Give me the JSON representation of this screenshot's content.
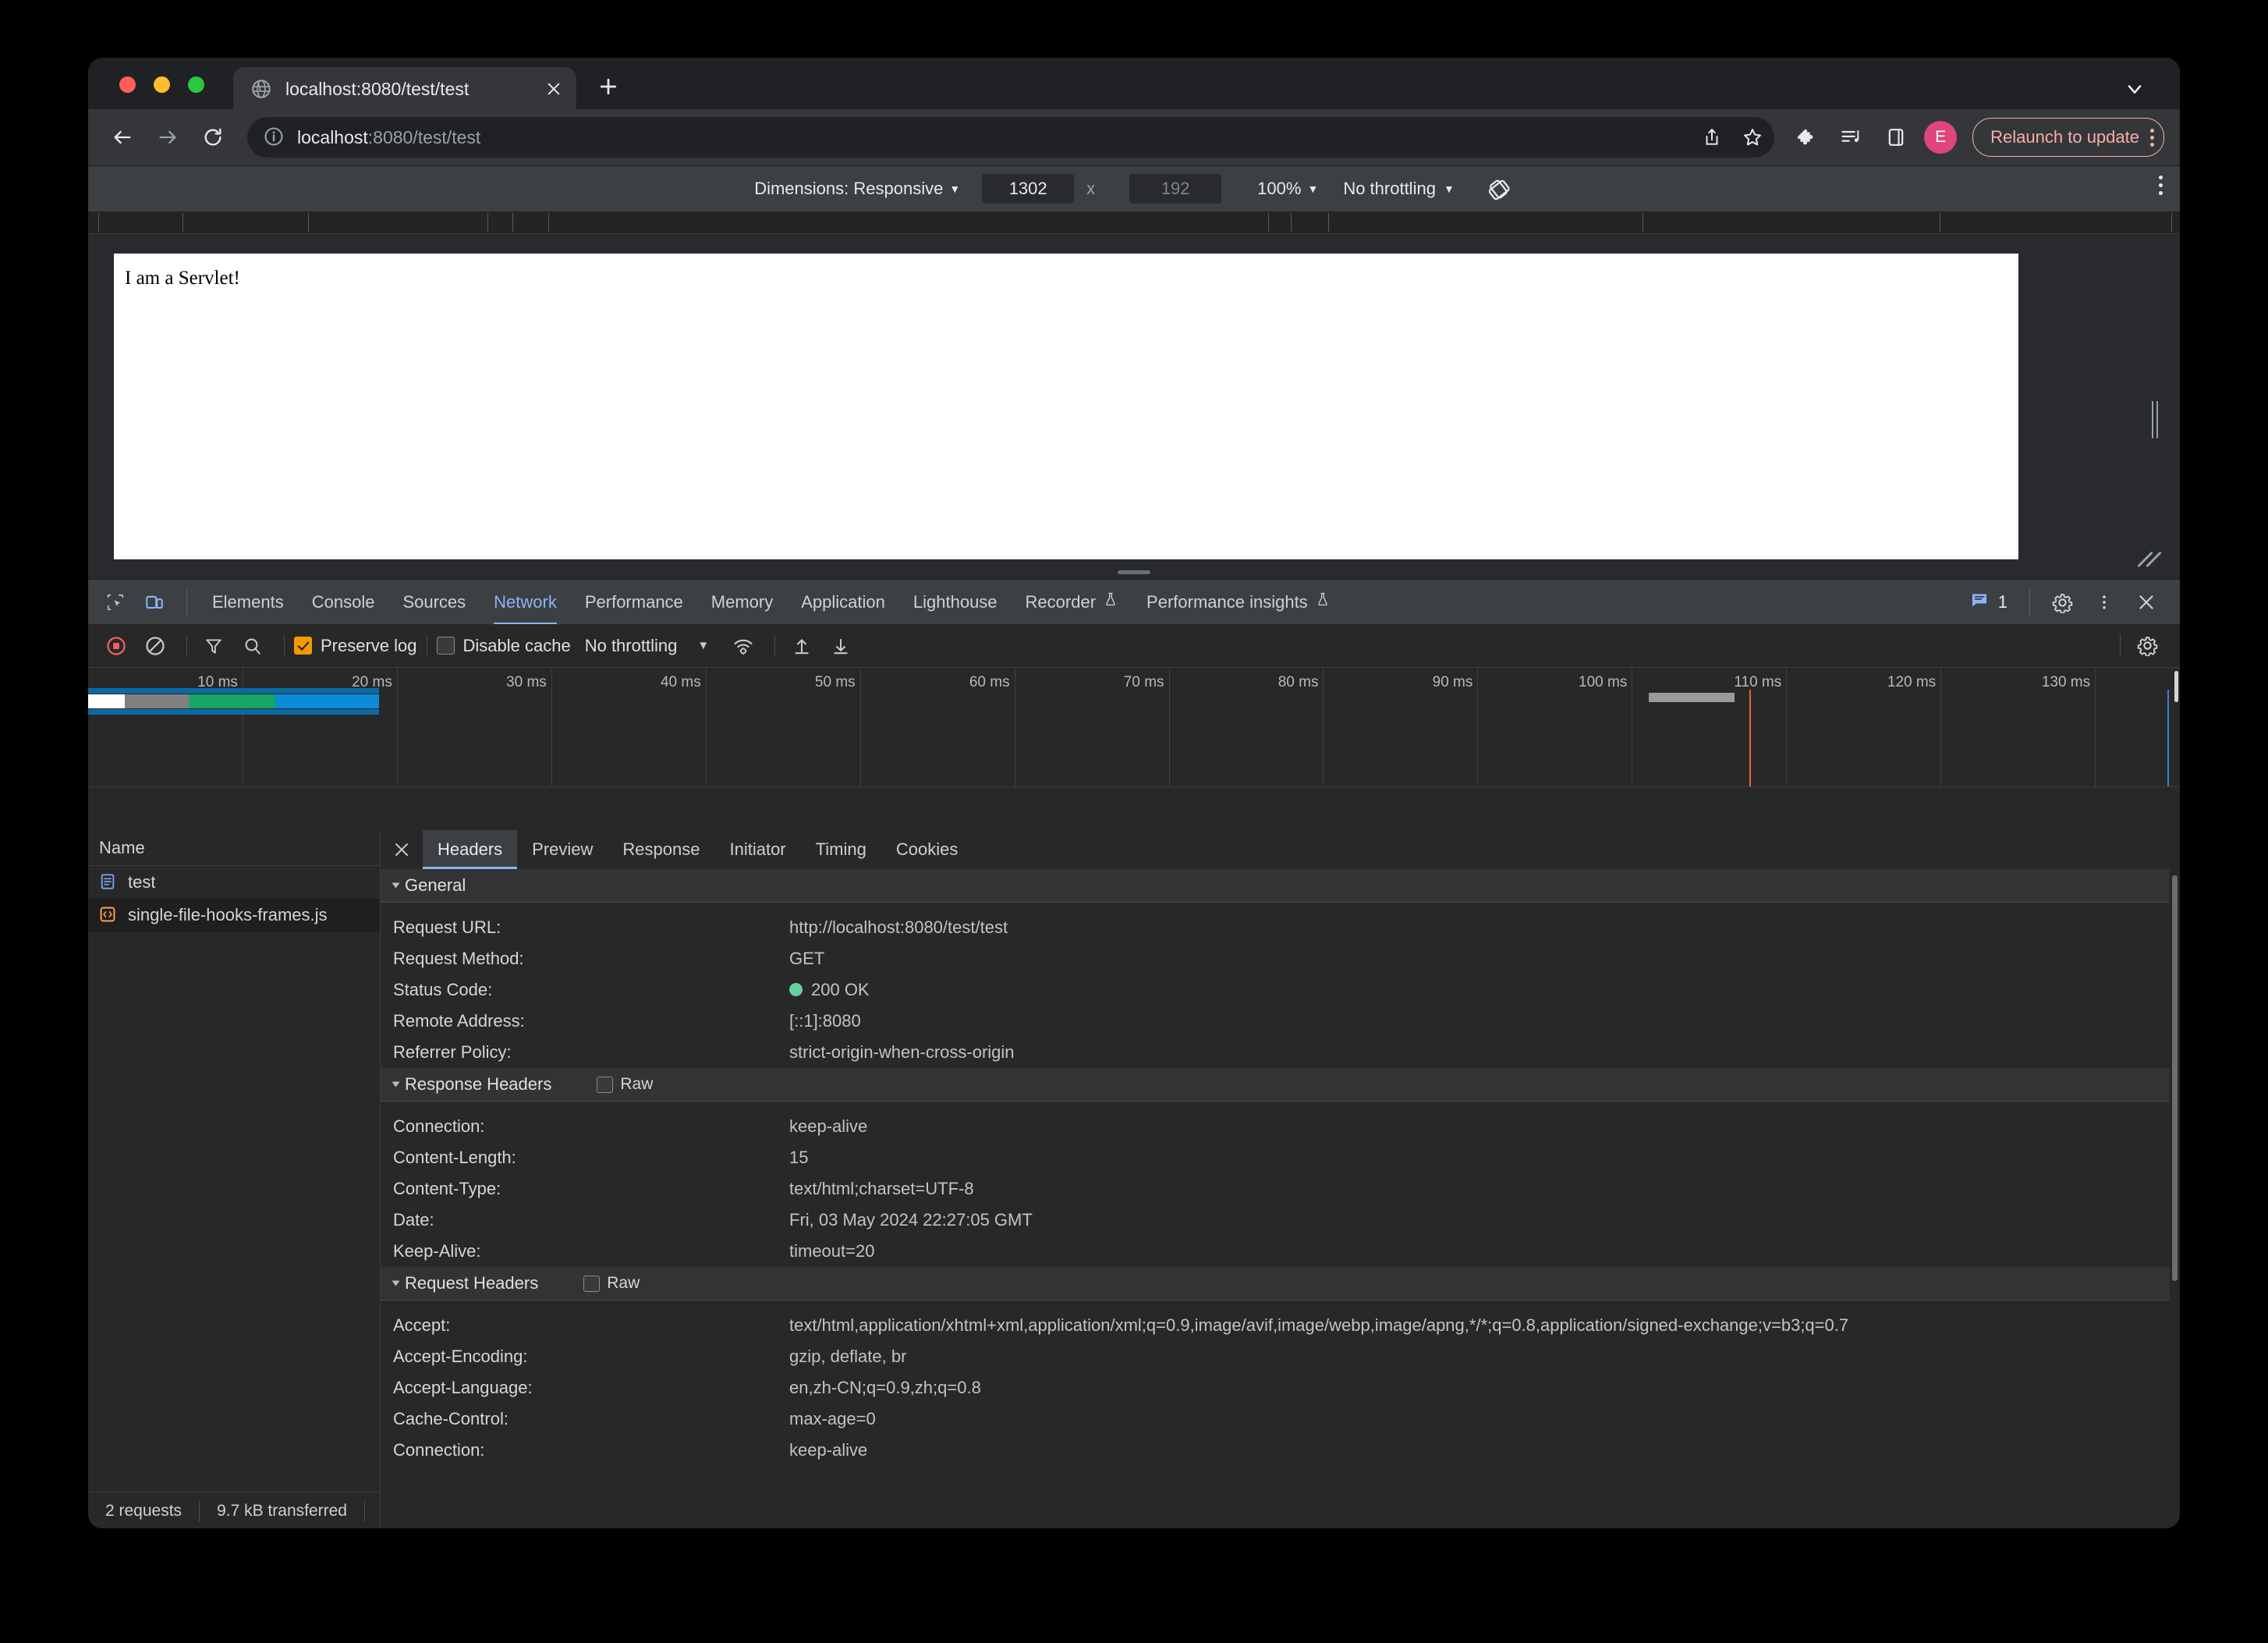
{
  "browser": {
    "tab": {
      "title": "localhost:8080/test/test",
      "favicon_icon": "globe-icon",
      "close_icon": "close-icon"
    },
    "new_tab_icon": "plus-icon",
    "tab_list_chevron_icon": "chevron-down-icon",
    "nav": {
      "back_icon": "arrow-left-icon",
      "forward_icon": "arrow-right-icon",
      "reload_icon": "reload-icon"
    },
    "omnibox": {
      "info_icon": "info-circle-icon",
      "url_host": "localhost",
      "url_rest": ":8080/test/test",
      "share_icon": "share-icon",
      "bookmark_icon": "star-icon"
    },
    "actions": {
      "extensions_icon": "puzzle-icon",
      "reading_list_icon": "media-list-icon",
      "side_panel_icon": "side-panel-icon",
      "avatar_label": "E",
      "avatar_color": "#e0457b",
      "relaunch_label": "Relaunch to update",
      "relaunch_color": "#f6aea9",
      "relaunch_menu_icon": "kebab-menu-icon"
    }
  },
  "device_toolbar": {
    "dimensions_label": "Dimensions: Responsive",
    "dimensions_caret_icon": "caret-down-icon",
    "width_value": "1302",
    "x_label": "x",
    "height_placeholder": "192",
    "zoom_label": "100%",
    "zoom_caret_icon": "caret-down-icon",
    "throttling_label": "No throttling",
    "throttling_caret_icon": "caret-down-icon",
    "rotate_icon": "rotate-device-icon",
    "more_icon": "kebab-menu-icon"
  },
  "page": {
    "body_text": "I am a Servlet!",
    "resize_handle_icon": "vertical-grip-icon",
    "corner_resize_icon": "corner-resize-icon",
    "drawer_grip_icon": "horizontal-grip-icon"
  },
  "devtools": {
    "inspect_icon": "inspect-element-icon",
    "device_toggle_icon": "device-toolbar-icon",
    "panels": [
      {
        "label": "Elements",
        "selected": false,
        "experimental": false
      },
      {
        "label": "Console",
        "selected": false,
        "experimental": false
      },
      {
        "label": "Sources",
        "selected": false,
        "experimental": false
      },
      {
        "label": "Network",
        "selected": true,
        "experimental": false
      },
      {
        "label": "Performance",
        "selected": false,
        "experimental": false
      },
      {
        "label": "Memory",
        "selected": false,
        "experimental": false
      },
      {
        "label": "Application",
        "selected": false,
        "experimental": false
      },
      {
        "label": "Lighthouse",
        "selected": false,
        "experimental": false
      },
      {
        "label": "Recorder",
        "selected": false,
        "experimental": true
      },
      {
        "label": "Performance insights",
        "selected": false,
        "experimental": true
      }
    ],
    "message_icon": "console-message-icon",
    "message_count": "1",
    "settings_icon": "gear-icon",
    "more_icon": "kebab-menu-icon",
    "close_icon": "close-icon"
  },
  "network_toolbar": {
    "record_icon": "record-stop-icon",
    "clear_icon": "clear-circle-icon",
    "filter_icon": "funnel-icon",
    "search_icon": "search-icon",
    "preserve_log_label": "Preserve log",
    "preserve_log_checked": true,
    "disable_cache_label": "Disable cache",
    "disable_cache_checked": false,
    "throttling_label": "No throttling",
    "throttling_caret_icon": "caret-down-icon",
    "wifi_icon": "network-conditions-icon",
    "import_icon": "upload-har-icon",
    "export_icon": "download-har-icon",
    "settings_icon": "gear-icon"
  },
  "overview": {
    "tick_labels": [
      "10 ms",
      "20 ms",
      "30 ms",
      "40 ms",
      "50 ms",
      "60 ms",
      "70 ms",
      "80 ms",
      "90 ms",
      "100 ms",
      "110 ms",
      "120 ms",
      "130 ms"
    ],
    "bar_segments": [
      {
        "name": "queueing",
        "color": "#ffffff",
        "left_pct": 0.0,
        "width_pct": 1.75
      },
      {
        "name": "stalled",
        "color": "#808080",
        "left_pct": 1.75,
        "width_pct": 3.05
      },
      {
        "name": "waiting",
        "color": "#19a463",
        "left_pct": 4.8,
        "width_pct": 4.15
      },
      {
        "name": "download",
        "color": "#0b8bd8",
        "left_pct": 8.95,
        "width_pct": 4.95
      }
    ],
    "underline_color": "#0b6aa6",
    "second_request_mark": {
      "color": "#9a9a9a",
      "left_pct": 74.6,
      "width_pct": 4.1
    },
    "dom_content_loaded_line_color": "#e8662a",
    "load_line_color": "#3a7ecf"
  },
  "request_list": {
    "column_header": "Name",
    "rows": [
      {
        "name": "test",
        "icon": "document-icon",
        "selected": true
      },
      {
        "name": "single-file-hooks-frames.js",
        "icon": "script-icon",
        "selected": false
      }
    ]
  },
  "status_bar": {
    "requests": "2 requests",
    "transferred": "9.7 kB transferred"
  },
  "details": {
    "close_icon": "close-icon",
    "tabs": [
      {
        "label": "Headers",
        "selected": true
      },
      {
        "label": "Preview",
        "selected": false
      },
      {
        "label": "Response",
        "selected": false
      },
      {
        "label": "Initiator",
        "selected": false
      },
      {
        "label": "Timing",
        "selected": false
      },
      {
        "label": "Cookies",
        "selected": false
      }
    ],
    "sections": [
      {
        "title": "General",
        "has_raw": false,
        "raw_label": "",
        "rows": [
          {
            "key": "Request URL:",
            "value": "http://localhost:8080/test/test",
            "status_dot": false
          },
          {
            "key": "Request Method:",
            "value": "GET",
            "status_dot": false
          },
          {
            "key": "Status Code:",
            "value": "200 OK",
            "status_dot": true,
            "dot_color": "#63d19e"
          },
          {
            "key": "Remote Address:",
            "value": "[::1]:8080",
            "status_dot": false
          },
          {
            "key": "Referrer Policy:",
            "value": "strict-origin-when-cross-origin",
            "status_dot": false
          }
        ]
      },
      {
        "title": "Response Headers",
        "has_raw": true,
        "raw_label": "Raw",
        "rows": [
          {
            "key": "Connection:",
            "value": "keep-alive",
            "status_dot": false
          },
          {
            "key": "Content-Length:",
            "value": "15",
            "status_dot": false
          },
          {
            "key": "Content-Type:",
            "value": "text/html;charset=UTF-8",
            "status_dot": false
          },
          {
            "key": "Date:",
            "value": "Fri, 03 May 2024 22:27:05 GMT",
            "status_dot": false
          },
          {
            "key": "Keep-Alive:",
            "value": "timeout=20",
            "status_dot": false
          }
        ]
      },
      {
        "title": "Request Headers",
        "has_raw": true,
        "raw_label": "Raw",
        "rows": [
          {
            "key": "Accept:",
            "value": "text/html,application/xhtml+xml,application/xml;q=0.9,image/avif,image/webp,image/apng,*/*;q=0.8,application/signed-exchange;v=b3;q=0.7",
            "status_dot": false
          },
          {
            "key": "Accept-Encoding:",
            "value": "gzip, deflate, br",
            "status_dot": false
          },
          {
            "key": "Accept-Language:",
            "value": "en,zh-CN;q=0.9,zh;q=0.8",
            "status_dot": false
          },
          {
            "key": "Cache-Control:",
            "value": "max-age=0",
            "status_dot": false
          },
          {
            "key": "Connection:",
            "value": "keep-alive",
            "status_dot": false
          }
        ]
      }
    ]
  }
}
